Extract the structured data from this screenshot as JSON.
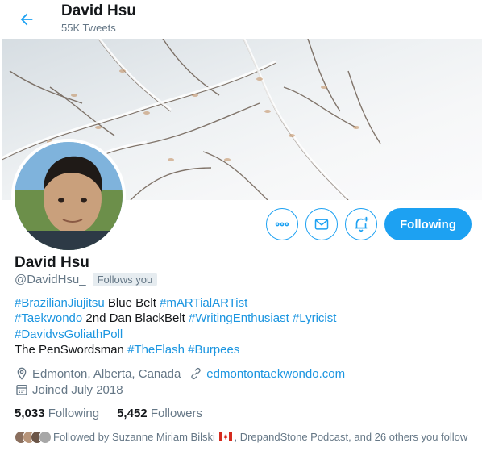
{
  "header": {
    "name": "David Hsu",
    "tweets": "55K Tweets"
  },
  "profile": {
    "name": "David Hsu",
    "handle": "@DavidHsu_",
    "follows_you": "Follows you"
  },
  "actions": {
    "follow_label": "Following"
  },
  "bio": {
    "line1_tag1": "#BrazilianJiujitsu",
    "line1_text": " Blue Belt ",
    "line1_tag2": "#mARTialARTist",
    "line2_tag1": "#Taekwondo",
    "line2_text": " 2nd Dan BlackBelt ",
    "line2_tag2": "#WritingEnthusiast",
    "line2_tag3": "#Lyricist",
    "line3_tag1": "#DavidvsGoliathPoll",
    "line4_text": "The PenSwordsman ",
    "line4_tag1": "#TheFlash",
    "line4_tag2": "#Burpees"
  },
  "meta": {
    "location": "Edmonton, Alberta, Canada",
    "website": "edmontontaekwondo.com",
    "joined": "Joined July 2018"
  },
  "stats": {
    "following_count": "5,033",
    "following_label": "Following",
    "followers_count": "5,452",
    "followers_label": "Followers"
  },
  "followed_by": {
    "prefix": "Followed by Suzanne Miriam Bilski",
    "suffix": ", DrepandStone Podcast, and 26 others you follow"
  },
  "colors": {
    "accent": "#1da1f2",
    "link": "#1b95e0",
    "secondary_text": "#657786"
  }
}
